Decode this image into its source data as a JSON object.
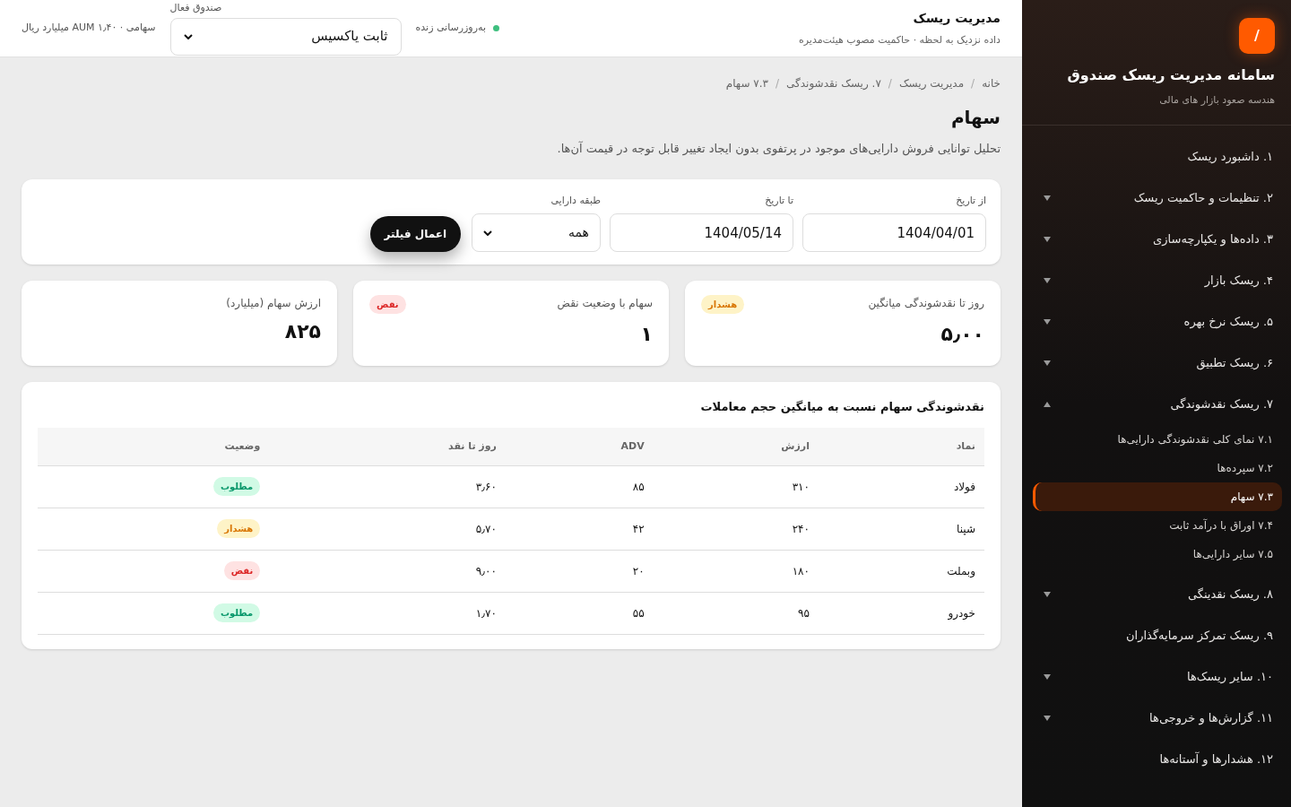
{
  "sidebar": {
    "logo": "/",
    "title": "سامانه مدیریت ریسک صندوق",
    "subtitle": "هندسه صعود بازار های مالی",
    "items": [
      {
        "label": "۱. داشبورد ریسک",
        "kind": "link"
      },
      {
        "label": "۲. تنظیمات و حاکمیت ریسک",
        "kind": "group",
        "expanded": false
      },
      {
        "label": "۳. داده‌ها و یکپارچه‌سازی",
        "kind": "group",
        "expanded": false
      },
      {
        "label": "۴. ریسک بازار",
        "kind": "group",
        "expanded": false
      },
      {
        "label": "۵. ریسک نرخ بهره",
        "kind": "group",
        "expanded": false
      },
      {
        "label": "۶. ریسک تطبیق",
        "kind": "group",
        "expanded": false
      },
      {
        "label": "۷. ریسک نقدشوندگی",
        "kind": "group",
        "expanded": true,
        "children": [
          {
            "label": "۷.۱ نمای کلی نقدشوندگی دارایی‌ها",
            "selected": false
          },
          {
            "label": "۷.۲ سپرده‌ها",
            "selected": false
          },
          {
            "label": "۷.۳ سهام",
            "selected": true
          },
          {
            "label": "۷.۴ اوراق با درآمد ثابت",
            "selected": false
          },
          {
            "label": "۷.۵ سایر دارایی‌ها",
            "selected": false
          }
        ]
      },
      {
        "label": "۸. ریسک نقدینگی",
        "kind": "group",
        "expanded": false
      },
      {
        "label": "۹. ریسک تمرکز سرمایه‌گذاران",
        "kind": "link"
      },
      {
        "label": "۱۰. سایر ریسک‌ها",
        "kind": "group",
        "expanded": false
      },
      {
        "label": "۱۱. گزارش‌ها و خروجی‌ها",
        "kind": "group",
        "expanded": false
      },
      {
        "label": "۱۲. هشدارها و آستانه‌ها",
        "kind": "link"
      }
    ]
  },
  "header": {
    "title": "مدیریت ریسک",
    "subtitle": "داده نزدیک به لحظه · حاکمیت مصوب هیئت‌مدیره",
    "live": "به‌روزرسانی زنده",
    "fund_label": "صندوق فعال",
    "fund": "ثابت یاکسیس",
    "aum": "سهامی · AUM ۱٫۴۰ میلیارد ریال"
  },
  "breadcrumb": {
    "separator": "/",
    "items": [
      "خانه",
      "مدیریت ریسک",
      "۷. ریسک نقدشوندگی",
      "۷.۳ سهام"
    ]
  },
  "page": {
    "title": "سهام",
    "description": "تحلیل توانایی فروش دارایی‌های موجود در پرتفوی بدون ایجاد تغییر قابل توجه در قیمت آن‌ها."
  },
  "filters": {
    "from_label": "از تاریخ",
    "from": "1404/04/01",
    "to_label": "تا تاریخ",
    "to": "1404/05/14",
    "class_label": "طبقه دارایی",
    "class": "همه",
    "apply": "اعمال فیلتر"
  },
  "kpis": [
    {
      "label": "روز تا نقدشوندگی میانگین",
      "value": "۵٫۰۰",
      "badge": "هشدار",
      "kind": "warn"
    },
    {
      "label": "سهام با وضعیت نقض",
      "value": "۱",
      "badge": "نقض",
      "kind": "breach"
    },
    {
      "label": "ارزش سهام (میلیارد)",
      "value": "۸۲۵"
    }
  ],
  "table": {
    "title": "نقدشوندگی سهام نسبت به میانگین حجم معاملات",
    "columns": [
      "نماد",
      "ارزش",
      "ADV",
      "روز تا نقد",
      "وضعیت"
    ],
    "rows": [
      {
        "symbol": "فولاد",
        "value": "۳۱۰",
        "adv": "۸۵",
        "days": "۳٫۶۰",
        "status_label": "مطلوب",
        "kind": "ok"
      },
      {
        "symbol": "شپنا",
        "value": "۲۴۰",
        "adv": "۴۲",
        "days": "۵٫۷۰",
        "status_label": "هشدار",
        "kind": "warn"
      },
      {
        "symbol": "وبملت",
        "value": "۱۸۰",
        "adv": "۲۰",
        "days": "۹٫۰۰",
        "status_label": "نقض",
        "kind": "breach"
      },
      {
        "symbol": "خودرو",
        "value": "۹۵",
        "adv": "۵۵",
        "days": "۱٫۷۰",
        "status_label": "مطلوب",
        "kind": "ok"
      }
    ]
  }
}
